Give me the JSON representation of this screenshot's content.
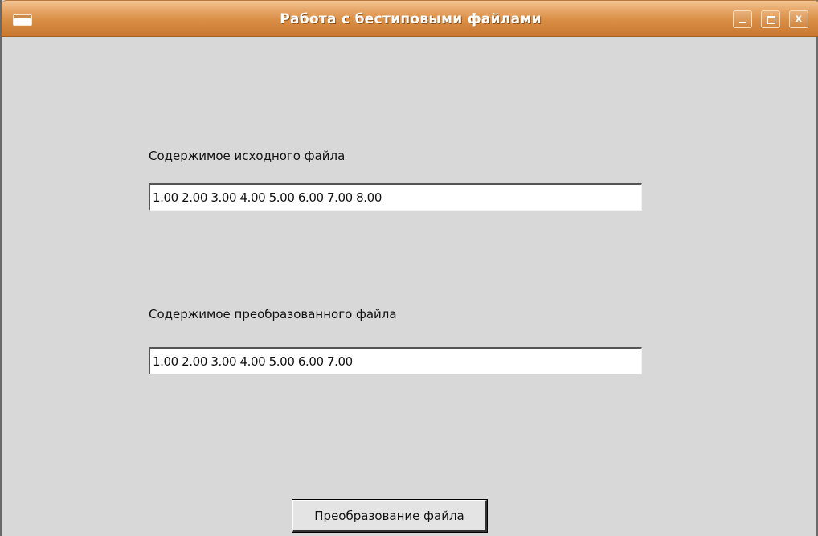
{
  "window": {
    "title": "Работа с бестиповыми файлами",
    "accent_color": "#d98e45",
    "background_color": "#d8d8d8",
    "controls": {
      "minimize_icon": "minimize-icon",
      "maximize_icon": "maximize-icon",
      "close_icon": "close-icon",
      "close_glyph": "x"
    }
  },
  "source": {
    "label": "Содержимое исходного файла",
    "value": "1.00 2.00 3.00 4.00 5.00 6.00 7.00 8.00"
  },
  "converted": {
    "label": "Содержимое преобразованного файла",
    "value": "1.00 2.00 3.00 4.00 5.00 6.00 7.00"
  },
  "actions": {
    "convert_label": "Преобразование файла"
  }
}
